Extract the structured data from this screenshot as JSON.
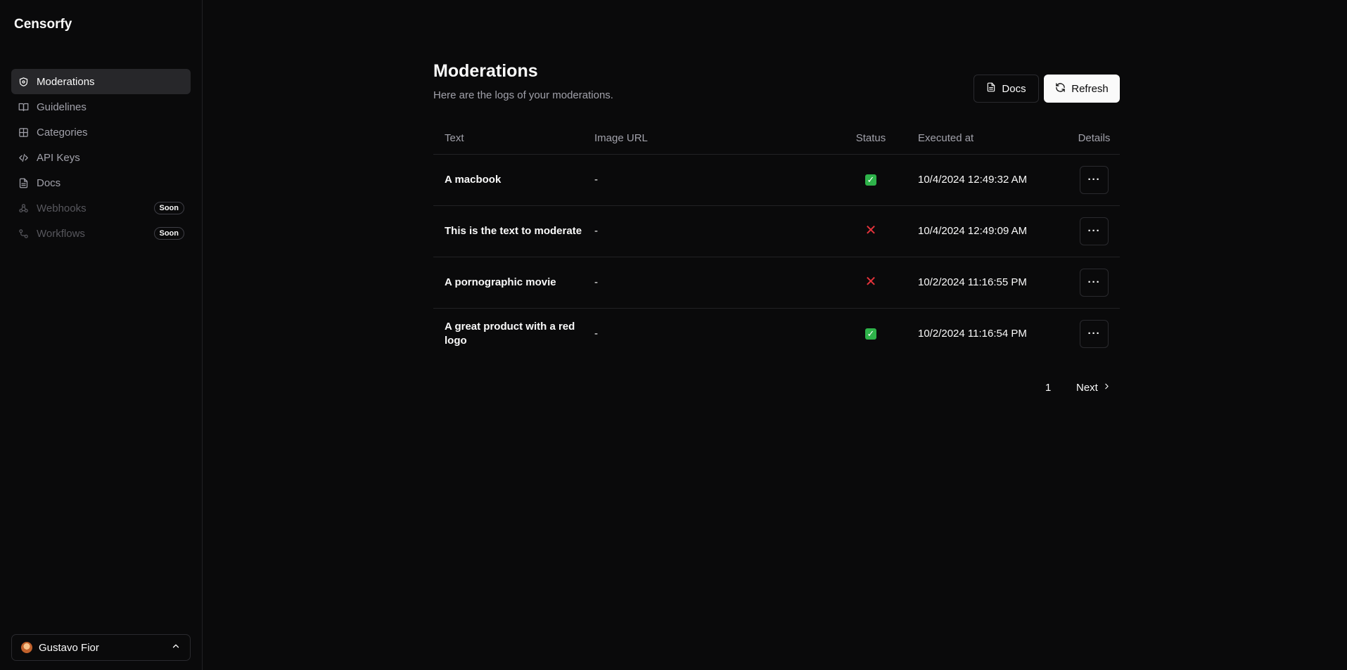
{
  "app": {
    "name": "Censorfy"
  },
  "sidebar": {
    "items": [
      {
        "label": "Moderations",
        "icon": "shield-icon",
        "active": true
      },
      {
        "label": "Guidelines",
        "icon": "book-open-icon"
      },
      {
        "label": "Categories",
        "icon": "grid-icon"
      },
      {
        "label": "API Keys",
        "icon": "code-icon"
      },
      {
        "label": "Docs",
        "icon": "file-text-icon"
      },
      {
        "label": "Webhooks",
        "icon": "webhook-icon",
        "badge": "Soon",
        "disabled": true
      },
      {
        "label": "Workflows",
        "icon": "workflow-icon",
        "badge": "Soon",
        "disabled": true
      }
    ],
    "user": {
      "name": "Gustavo Fior",
      "icon": "chevron-up-icon"
    }
  },
  "main": {
    "title": "Moderations",
    "subtitle": "Here are the logs of your moderations.",
    "docs_label": "Docs",
    "refresh_label": "Refresh",
    "table": {
      "headers": {
        "text": "Text",
        "image_url": "Image URL",
        "status": "Status",
        "executed_at": "Executed at",
        "details": "Details"
      },
      "rows": [
        {
          "text": "A macbook",
          "image_url": "-",
          "status": "approved",
          "executed_at": "10/4/2024 12:49:32 AM"
        },
        {
          "text": "This is the text to moderate",
          "image_url": "-",
          "status": "rejected",
          "executed_at": "10/4/2024 12:49:09 AM"
        },
        {
          "text": "A pornographic movie",
          "image_url": "-",
          "status": "rejected",
          "executed_at": "10/2/2024 11:16:55 PM"
        },
        {
          "text": "A great product with a red logo",
          "image_url": "-",
          "status": "approved",
          "executed_at": "10/2/2024 11:16:54 PM"
        }
      ]
    },
    "pagination": {
      "page": "1",
      "next_label": "Next"
    }
  }
}
